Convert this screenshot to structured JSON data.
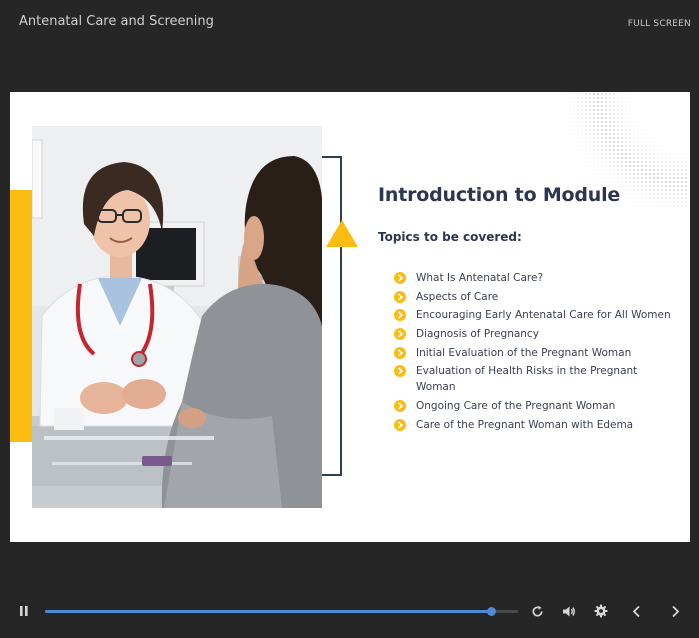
{
  "header": {
    "title": "Antenatal Care and Screening",
    "fullscreen_label": "FULL SCREEN"
  },
  "slide": {
    "title": "Introduction to Module",
    "topics_label": "Topics to be covered:",
    "topics": [
      "What Is Antenatal Care?",
      "Aspects of Care",
      "Encouraging Early Antenatal Care for All Women",
      "Diagnosis of Pregnancy",
      "Initial Evaluation of the Pregnant Woman",
      "Evaluation of Health Risks in the Pregnant Woman",
      "Ongoing Care of the Pregnant Woman",
      "Care of the Pregnant Woman with Edema"
    ],
    "accent_color": "#fbbc11",
    "heading_color": "#2d3650"
  },
  "player": {
    "progress": 0.945,
    "progress_color": "#4f8ad3",
    "icons": [
      "pause-icon",
      "replay-icon",
      "volume-icon",
      "gear-icon",
      "chevron-left-icon",
      "chevron-right-icon"
    ]
  }
}
